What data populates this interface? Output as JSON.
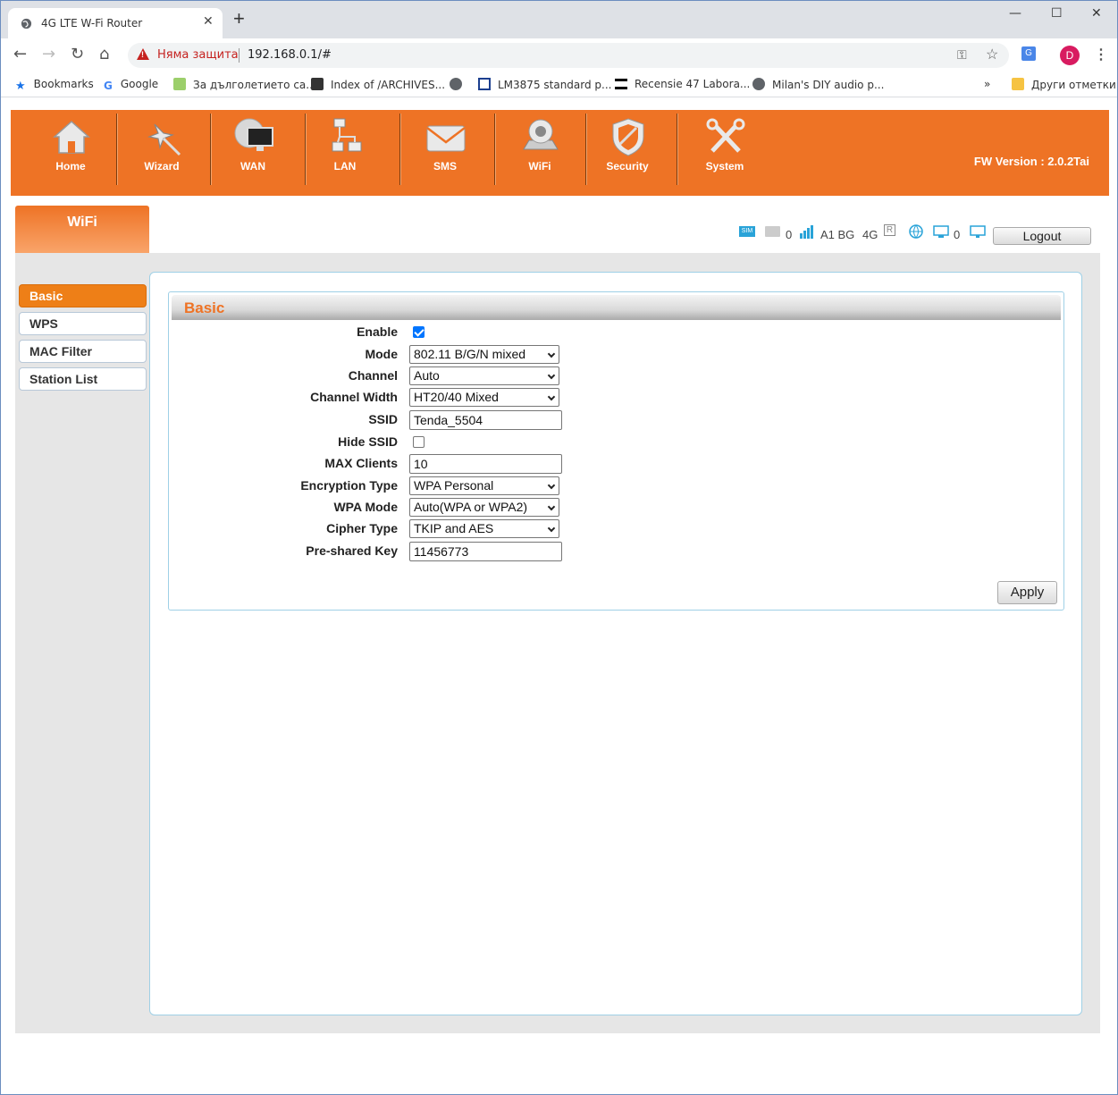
{
  "browser": {
    "tab_title": "4G LTE W-Fi Router",
    "new_tab": "+",
    "security_label": "Няма защита",
    "url": "192.168.0.1/#",
    "avatar_letter": "D",
    "bookmarks": [
      {
        "label": "Bookmarks"
      },
      {
        "label": "Google"
      },
      {
        "label": "За дълголетието са..."
      },
      {
        "label": "Index of /ARCHIVES..."
      },
      {
        "label": ""
      },
      {
        "label": "LM3875 standard p..."
      },
      {
        "label": "Recensie 47 Labora..."
      },
      {
        "label": "Milan's DIY audio p..."
      }
    ],
    "bookmarks_overflow": "»",
    "other_bookmarks": "Други отметки"
  },
  "router": {
    "nav": [
      {
        "label": "Home",
        "icon": "home-icon"
      },
      {
        "label": "Wizard",
        "icon": "wand-icon"
      },
      {
        "label": "WAN",
        "icon": "globe-monitor-icon"
      },
      {
        "label": "LAN",
        "icon": "network-icon"
      },
      {
        "label": "SMS",
        "icon": "envelope-icon"
      },
      {
        "label": "WiFi",
        "icon": "router-icon"
      },
      {
        "label": "Security",
        "icon": "shield-icon"
      },
      {
        "label": "System",
        "icon": "tools-icon"
      }
    ],
    "fw_version": "FW Version : 2.0.2Tai",
    "page_tab": "WiFi",
    "status": {
      "sms_count": "0",
      "operator": "A1 BG",
      "network": "4G",
      "roaming": "R",
      "clients": "0"
    },
    "logout": "Logout",
    "sidebar": [
      {
        "label": "Basic",
        "active": true
      },
      {
        "label": "WPS"
      },
      {
        "label": "MAC Filter"
      },
      {
        "label": "Station List"
      }
    ],
    "panel_title": "Basic",
    "form": {
      "enable": {
        "label": "Enable",
        "checked": true
      },
      "mode": {
        "label": "Mode",
        "value": "802.11 B/G/N mixed"
      },
      "channel": {
        "label": "Channel",
        "value": "Auto"
      },
      "channel_width": {
        "label": "Channel Width",
        "value": "HT20/40 Mixed"
      },
      "ssid": {
        "label": "SSID",
        "value": "Tenda_5504"
      },
      "hide_ssid": {
        "label": "Hide SSID",
        "checked": false
      },
      "max_clients": {
        "label": "MAX Clients",
        "value": "10"
      },
      "encryption": {
        "label": "Encryption Type",
        "value": "WPA Personal"
      },
      "wpa_mode": {
        "label": "WPA Mode",
        "value": "Auto(WPA or WPA2)"
      },
      "cipher": {
        "label": "Cipher Type",
        "value": "TKIP and AES"
      },
      "psk": {
        "label": "Pre-shared Key",
        "value": "11456773"
      }
    },
    "apply": "Apply"
  },
  "colors": {
    "brand_orange": "#ee7325",
    "active_tab": "#ee7f17",
    "panel_border": "#9fd0e6"
  }
}
